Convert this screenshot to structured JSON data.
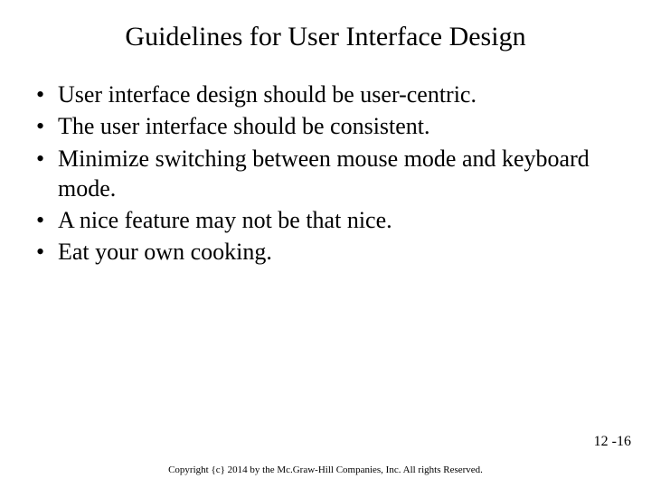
{
  "title": "Guidelines for User Interface Design",
  "bullets": [
    "User interface design should be user-centric.",
    "The user interface should be consistent.",
    "Minimize switching between mouse mode and keyboard mode.",
    "A nice feature may not be that nice.",
    "Eat your own cooking."
  ],
  "page_number": "12 -16",
  "copyright": "Copyright {c} 2014 by the Mc.Graw-Hill Companies, Inc. All rights Reserved."
}
